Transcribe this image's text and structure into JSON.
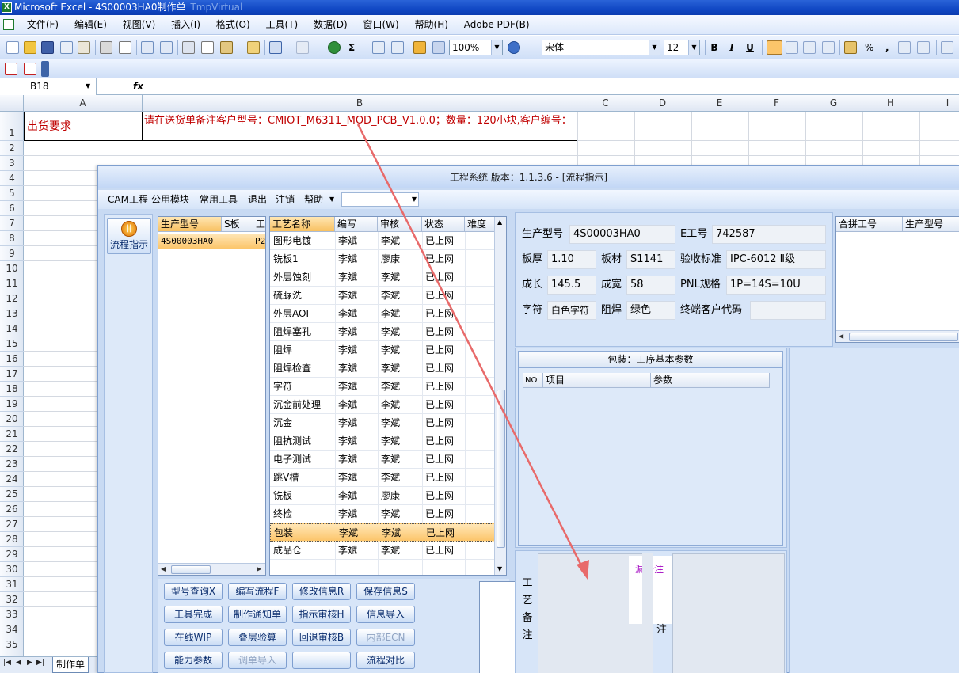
{
  "excel": {
    "title": "Microsoft Excel - 4S00003HA0制作单",
    "title_ghost": "TmpVirtual",
    "menu": [
      "文件(F)",
      "编辑(E)",
      "视图(V)",
      "插入(I)",
      "格式(O)",
      "工具(T)",
      "数据(D)",
      "窗口(W)",
      "帮助(H)",
      "Adobe PDF(B)"
    ],
    "zoom": "100%",
    "font": "宋体",
    "font_size": "12",
    "format_buttons": [
      "B",
      "I",
      "U"
    ],
    "percent": "%",
    "comma": ",",
    "name_box": "B18",
    "fx": "fx",
    "columns": [
      "A",
      "B",
      "C",
      "D",
      "E",
      "F",
      "G",
      "H",
      "I"
    ],
    "rows": [
      "1",
      "2",
      "3",
      "4",
      "5",
      "6",
      "7",
      "8",
      "9",
      "10",
      "11",
      "12",
      "13",
      "14",
      "15",
      "16",
      "17",
      "18",
      "19",
      "20",
      "21",
      "22",
      "23",
      "24",
      "25",
      "26",
      "27",
      "28",
      "29",
      "30",
      "31",
      "32",
      "33",
      "34",
      "35"
    ],
    "cell_a1": "出货要求",
    "cell_b1": "请在送货单备注客户型号：CMIOT_M6311_MOD_PCB_V1.0.0；数量：120小块,客户编号：",
    "sheet_tab": "制作单"
  },
  "app": {
    "title": "工程系统  版本：1.1.3.6 - [流程指示]",
    "menu": [
      "CAM工程",
      "公用模块",
      "常用工具",
      "退出",
      "注销",
      "帮助"
    ],
    "flow_button": "流程指示",
    "product_table": {
      "headers": [
        "生产型号",
        "S板",
        "工"
      ],
      "row": [
        "4S00003HA0",
        "P2"
      ]
    },
    "process_table": {
      "headers": [
        "工艺名称",
        "编写",
        "审核",
        "状态",
        "难度"
      ],
      "rows": [
        [
          "图形电镀",
          "李斌",
          "李斌",
          "已上网"
        ],
        [
          "铣板1",
          "李斌",
          "廖康",
          "已上网"
        ],
        [
          "外层蚀刻",
          "李斌",
          "李斌",
          "已上网"
        ],
        [
          "硫脲洗",
          "李斌",
          "李斌",
          "已上网"
        ],
        [
          "外层AOI",
          "李斌",
          "李斌",
          "已上网"
        ],
        [
          "阻焊塞孔",
          "李斌",
          "李斌",
          "已上网"
        ],
        [
          "阻焊",
          "李斌",
          "李斌",
          "已上网"
        ],
        [
          "阻焊检查",
          "李斌",
          "李斌",
          "已上网"
        ],
        [
          "字符",
          "李斌",
          "李斌",
          "已上网"
        ],
        [
          "沉金前处理",
          "李斌",
          "李斌",
          "已上网"
        ],
        [
          "沉金",
          "李斌",
          "李斌",
          "已上网"
        ],
        [
          "阻抗测试",
          "李斌",
          "李斌",
          "已上网"
        ],
        [
          "电子测试",
          "李斌",
          "李斌",
          "已上网"
        ],
        [
          "跳V槽",
          "李斌",
          "李斌",
          "已上网"
        ],
        [
          "铣板",
          "李斌",
          "廖康",
          "已上网"
        ],
        [
          "终检",
          "李斌",
          "李斌",
          "已上网"
        ],
        [
          "包装",
          "李斌",
          "李斌",
          "已上网"
        ],
        [
          "成品仓",
          "李斌",
          "李斌",
          "已上网"
        ]
      ],
      "selected_index": 16
    },
    "buttons": [
      [
        "型号查询X",
        "编写流程F",
        "修改信息R",
        "保存信息S"
      ],
      [
        "工具完成",
        "制作通知单",
        "指示审核H",
        "信息导入"
      ],
      [
        "在线WIP",
        "叠层验算",
        "回退审核B",
        "内部ECN"
      ],
      [
        "能力参数",
        "调单导入",
        "",
        "流程对比"
      ]
    ],
    "disabled_buttons": [
      "内部ECN",
      "调单导入"
    ],
    "info": {
      "prod_label": "生产型号",
      "prod_value": "4S00003HA0",
      "e_label": "E工号",
      "e_value": "742587",
      "thick_label": "板厚",
      "thick_value": "1.10",
      "mat_label": "板材",
      "mat_value": "S1141",
      "std_label": "验收标准",
      "std_value": "IPC-6012 Ⅱ级",
      "len_label": "成长",
      "len_value": "145.5",
      "wid_label": "成宽",
      "wid_value": "58",
      "pnl_label": "PNL规格",
      "pnl_value": "1P=14S=10U",
      "char_label": "字符",
      "char_value": "白色字符",
      "mask_label": "阻焊",
      "mask_value": "绿色",
      "cust_label": "终端客户代码",
      "cust_value": ""
    },
    "merge_table_headers": [
      "合拼工号",
      "生产型号"
    ],
    "params": {
      "title": "包装：工序基本参数",
      "headers": [
        "NO",
        "项目",
        "参数"
      ]
    },
    "notes": {
      "label": "工艺备注",
      "text": "漏备注",
      "label2": "注"
    }
  },
  "colors": {
    "red_text": "#c00000",
    "highlight": "#fcc56a",
    "arrow": "#e86a6a",
    "note_text": "#a000c0"
  }
}
